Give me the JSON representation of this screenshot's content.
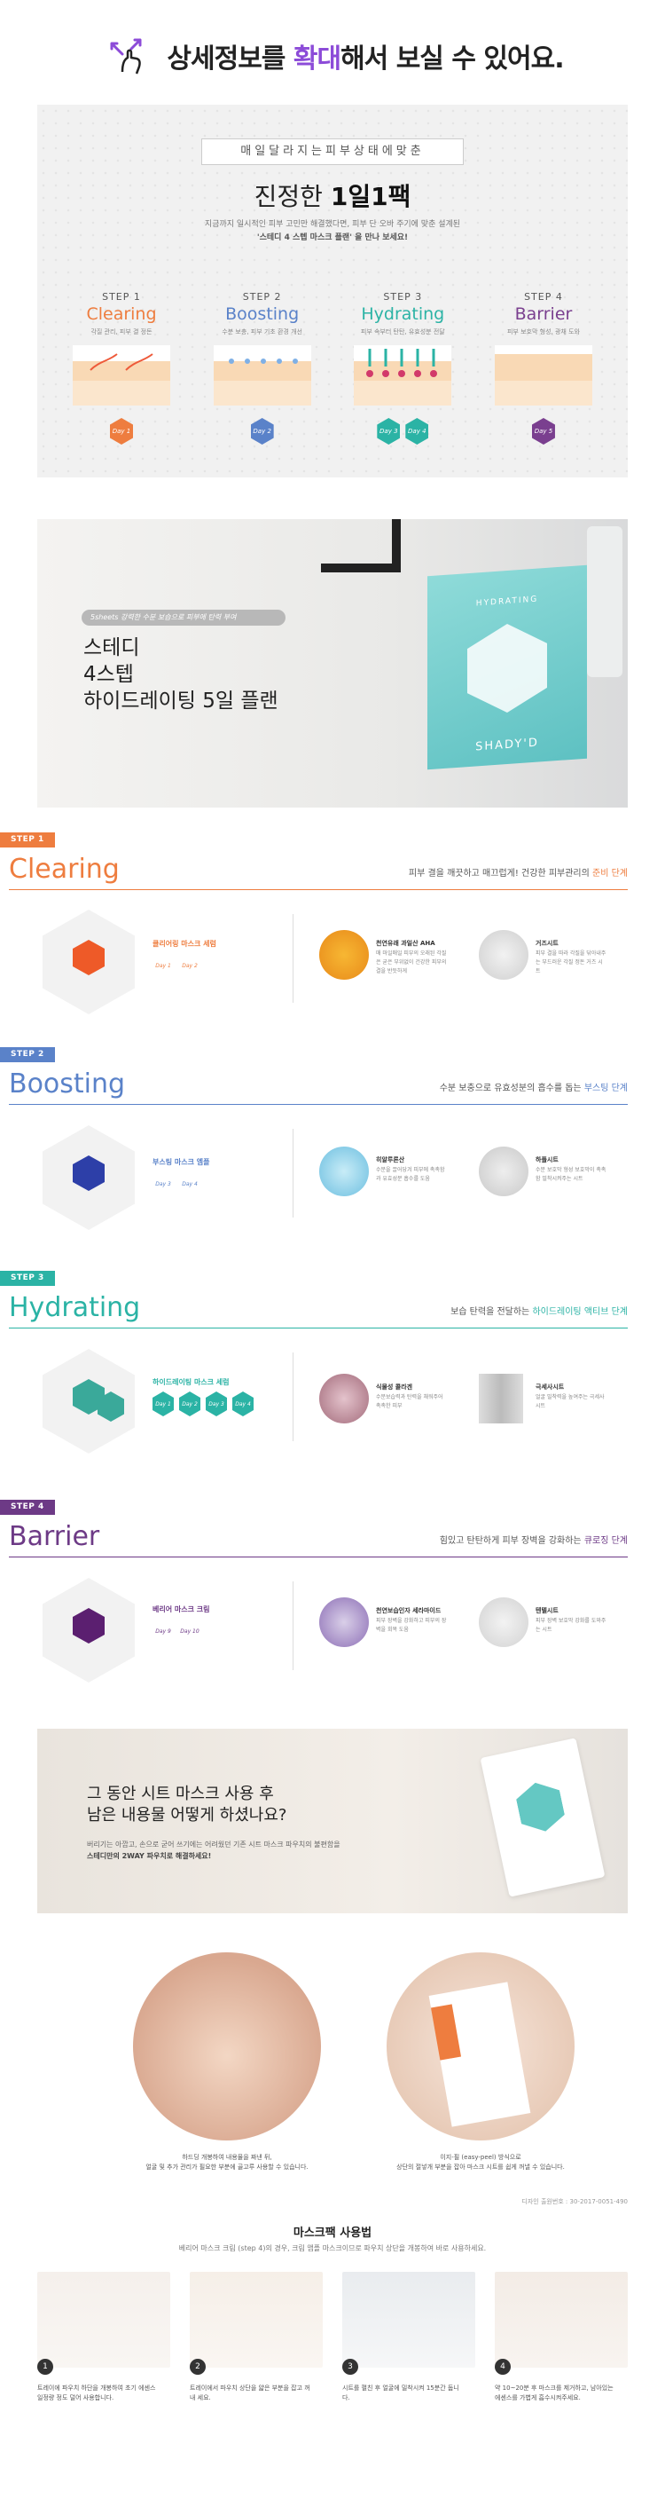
{
  "zoom": {
    "text_prefix": "상세정보를 ",
    "text_highlight": "확대",
    "text_suffix": "해서 보실 수 있어요."
  },
  "hero": {
    "kicker": "매일달라지는피부상태에맞춘",
    "title_prefix": "진정한 ",
    "title_bold": "1일1팩",
    "desc_line1": "지금까지 일시적인 피부 고민만 해결했다면, 피부 단 오바 주기에 맞춘 설계된",
    "desc_line2": "'스테디 4 스텝 마스크 플랜' 을 만나 보세요!"
  },
  "steps": [
    {
      "label": "STEP 1",
      "name": "Clearing",
      "sub": "각질 관리, 피부 결 정돈",
      "color": "#ee7d3f",
      "days": [
        "Day 1"
      ]
    },
    {
      "label": "STEP 2",
      "name": "Boosting",
      "sub": "수분 보충, 피부 기초 환경 개선",
      "color": "#5a82c9",
      "days": [
        "Day 2"
      ]
    },
    {
      "label": "STEP 3",
      "name": "Hydrating",
      "sub": "피부 속부터 탄탄, 유효성분 전달",
      "color": "#2bb3a5",
      "days": [
        "Day 3",
        "Day 4"
      ]
    },
    {
      "label": "STEP 4",
      "name": "Barrier",
      "sub": "피부 보호막 형성, 광채 도와",
      "color": "#7a3f8f",
      "days": [
        "Day 5"
      ]
    }
  ],
  "product": {
    "pill": "5sheets 강력한 수분 보습으로 피부에 탄력 부여",
    "line1": "스테디",
    "line2": "4스텝",
    "line3": "하이드레이팅 5일 플랜",
    "box_title": "HYDRATING",
    "brand": "SHADY'D"
  },
  "sections": [
    {
      "tag": "STEP 1",
      "name": "Clearing",
      "color": "#ee7d3f",
      "right_prefix": "피부 결을 깨끗하고 매끄럽게! 건강한 피부관리의 ",
      "right_highlight": "준비 단계",
      "product": "클리어링 마스크 세럼",
      "days": [
        "Day 1",
        "Day 2"
      ],
      "ing1_name": "천연유래 과일산 AHA",
      "ing1_desc": "매 마일매일 피부의 오래된 각질은 굳은 부위없이 건강한 피부의 결을 반듯하게",
      "ing2_name": "거즈시트",
      "ing2_desc": "피부 결을 따라 각질을 닦아내주는 부드러운 각질 정돈 거즈 시트"
    },
    {
      "tag": "STEP 2",
      "name": "Boosting",
      "color": "#5a82c9",
      "right_prefix": "수분 보충으로 유효성분의 흡수를 돕는 ",
      "right_highlight": "부스팅 단계",
      "product": "부스팅 마스크 엠플",
      "days": [
        "Day 3",
        "Day 4"
      ],
      "ing1_name": "히알루론산",
      "ing1_desc": "수분을 끌어당겨 피부에 촉촉함과 유효성분 흡수를 도움",
      "ing2_name": "하플시트",
      "ing2_desc": "수분 보호막 형성 보호막이 촉촉함 밀착시켜주는 시트"
    },
    {
      "tag": "STEP 3",
      "name": "Hydrating",
      "color": "#2bb3a5",
      "right_prefix": "보습 탄력을 전달하는 ",
      "right_highlight": "하이드레이팅 액티브 단계",
      "product": "하이드레이팅 마스크 세럼",
      "days": [
        "Day 1",
        "Day 2",
        "Day 3",
        "Day 4"
      ],
      "ing1_name": "식물성 콜라겐",
      "ing1_desc": "수분보습력과 탄력을 채워주어 촉촉한 피부",
      "ing2_name": "극세사시트",
      "ing2_desc": "얼굴 밀착력을 높여주는 극세사 시트"
    },
    {
      "tag": "STEP 4",
      "name": "Barrier",
      "color": "#6d3a86",
      "right_prefix": "힘있고 탄탄하게 피부 장벽을 강화하는 ",
      "right_highlight": "큐로징 단계",
      "product": "베리어 마스크 크림",
      "days": [
        "Day 9",
        "Day 10"
      ],
      "ing1_name": "천연보습인자 세라마이드",
      "ing1_desc": "피부 장벽을 강화하고 피부의 장벽을 회복 도움",
      "ing2_name": "텐텔시트",
      "ing2_desc": "피부 장벽 보호막 강화를 도와주는 시트"
    }
  ],
  "question": {
    "line1": "그 동안 시트 마스크 사용 후",
    "line2": "남은 내용물 어떻게 하셨나요?",
    "desc1": "버리기는 아깝고, 손으로 굳어 쓰기에는 어려웠던 기존 시트 마스크 파우치의 불편함을",
    "desc2": "스테디만의 2WAY 파우치로 해결하세요!"
  },
  "photos": {
    "caption_left_1": "하드딩 개봉하여 내용물을 짜낸 뒤,",
    "caption_left_2": "얼굴 및 추가 관리가 필요한 부분에 골고루 사용할 수 있습니다.",
    "caption_right_1": "이지-필 (easy-peel) 방식으로",
    "caption_right_2": "상단의 절넣개 부분을 잡아 마스크 시트를 쉽게 꺼낼 수 있습니다.",
    "footnote": "디자인 출원번호 : 30-2017-0051-490"
  },
  "guide": {
    "title": "마스크팩 사용법",
    "desc": "베리어 마스크 크림 (step 4)의 경우, 크림 앰플 마스크이므로 파우치 상단을 개봉하여 바로 사용하세요.",
    "items": [
      {
        "num": "1",
        "text": "트레이에 파우치 하단을 개봉하여 초기 에센스 일정량 정도 덜어 사용합니다."
      },
      {
        "num": "2",
        "text": "트레이에서 파우치 상단을 얇은 부분을 잡고 꺼내 세요."
      },
      {
        "num": "3",
        "text": "시트를 펼친 후 얼굴에 밀착시켜 15분간 둡니다."
      },
      {
        "num": "4",
        "text": "약 10~20분 후 마스크를 제거하고, 남아있는 에센스를 가볍게 흡수시켜주세요."
      }
    ]
  },
  "colors": {
    "accent_purple": "#8c4bd8"
  }
}
